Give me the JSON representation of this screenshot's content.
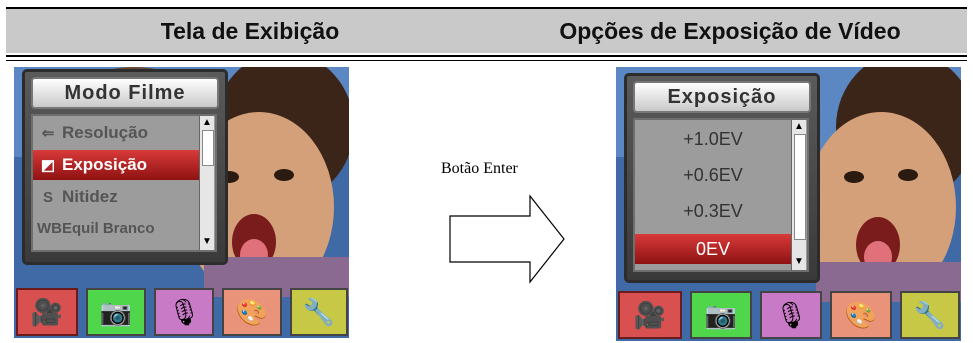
{
  "header": {
    "left_title": "Tela de Exibição",
    "right_title": "Opções de Exposição de Vídeo"
  },
  "left_screen": {
    "menu_title": "Modo Filme",
    "items": [
      {
        "icon": "resolution-icon",
        "glyph": "⇐",
        "label": "Resolução",
        "selected": false
      },
      {
        "icon": "exposure-icon",
        "glyph": "◩",
        "label": "Exposição",
        "selected": true
      },
      {
        "icon": "sharpness-icon",
        "glyph": "S",
        "label": "Nitidez",
        "selected": false
      },
      {
        "icon": "white-balance-icon",
        "glyph": "WB",
        "label": "Equil Branco",
        "selected": false
      }
    ]
  },
  "right_screen": {
    "menu_title": "Exposição",
    "items": [
      {
        "label": "+1.0EV",
        "selected": false
      },
      {
        "label": "+0.6EV",
        "selected": false
      },
      {
        "label": "+0.3EV",
        "selected": false
      },
      {
        "label": "0EV",
        "selected": true
      }
    ]
  },
  "tabs": [
    {
      "icon": "movie-camera-icon",
      "glyph": "🎥",
      "color": "#d95050"
    },
    {
      "icon": "camera-icon",
      "glyph": "📷",
      "color": "#4fd64a"
    },
    {
      "icon": "microphone-icon",
      "glyph": "🎙",
      "color": "#c97ac7"
    },
    {
      "icon": "palette-icon",
      "glyph": "🎨",
      "color": "#e8937a"
    },
    {
      "icon": "tools-icon",
      "glyph": "🔧",
      "color": "#c7c946"
    }
  ],
  "arrow": {
    "label": "Botão Enter"
  }
}
